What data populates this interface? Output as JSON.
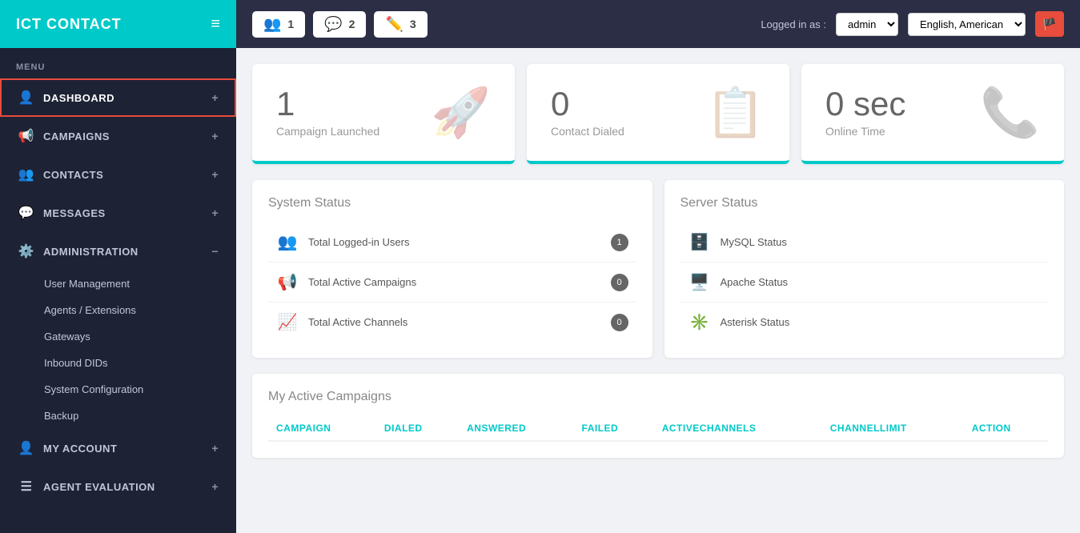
{
  "brand": {
    "title": "ICT CONTACT"
  },
  "sidebar": {
    "menu_label": "MENU",
    "items": [
      {
        "id": "dashboard",
        "label": "DASHBOARD",
        "icon": "👤",
        "plus": "+",
        "active": true
      },
      {
        "id": "campaigns",
        "label": "CAMPAIGNS",
        "icon": "📢",
        "plus": "+"
      },
      {
        "id": "contacts",
        "label": "CONTACTS",
        "icon": "👥",
        "plus": "+"
      },
      {
        "id": "messages",
        "label": "MESSAGES",
        "icon": "💬",
        "plus": "+"
      },
      {
        "id": "administration",
        "label": "ADMINISTRATION",
        "icon": "⚙️",
        "plus": "−"
      }
    ],
    "sub_items": [
      "User Management",
      "Agents / Extensions",
      "Gateways",
      "Inbound DIDs",
      "System Configuration",
      "Backup"
    ],
    "bottom_items": [
      {
        "id": "my-account",
        "label": "MY ACCOUNT",
        "icon": "👤",
        "plus": "+"
      },
      {
        "id": "agent-evaluation",
        "label": "AGENT EVALUATION",
        "icon": "☰",
        "plus": "+"
      }
    ]
  },
  "header": {
    "tabs": [
      {
        "icon": "👥",
        "number": "1"
      },
      {
        "icon": "💬",
        "number": "2"
      },
      {
        "icon": "✏️",
        "number": "3"
      }
    ],
    "logged_in_label": "Logged in as :",
    "admin_value": "admin",
    "lang_value": "English, American",
    "admin_options": [
      "admin"
    ],
    "lang_options": [
      "English, American"
    ]
  },
  "stats": [
    {
      "id": "campaign-launched",
      "number": "1",
      "label": "Campaign Launched",
      "icon": "🚀"
    },
    {
      "id": "contact-dialed",
      "number": "0",
      "label": "Contact Dialed",
      "icon": "📋"
    },
    {
      "id": "online-time",
      "number": "0 sec",
      "label": "Online Time",
      "icon": "📞"
    }
  ],
  "system_status": {
    "title": "System Status",
    "items": [
      {
        "id": "logged-users",
        "label": "Total Logged-in Users",
        "icon_type": "users",
        "count": "1"
      },
      {
        "id": "active-campaigns",
        "label": "Total Active Campaigns",
        "icon_type": "campaign",
        "count": "0"
      },
      {
        "id": "active-channels",
        "label": "Total Active Channels",
        "icon_type": "chart",
        "count": "0"
      }
    ]
  },
  "server_status": {
    "title": "Server Status",
    "items": [
      {
        "id": "mysql",
        "label": "MySQL Status",
        "icon_type": "db"
      },
      {
        "id": "apache",
        "label": "Apache Status",
        "icon_type": "server"
      },
      {
        "id": "asterisk",
        "label": "Asterisk Status",
        "icon_type": "asterisk"
      }
    ]
  },
  "campaigns_section": {
    "title": "My Active Campaigns",
    "columns": [
      "CAMPAIGN",
      "DIALED",
      "ANSWERED",
      "FAILED",
      "ACTIVECHANNELS",
      "CHANNELLIMIT",
      "ACTION"
    ]
  }
}
